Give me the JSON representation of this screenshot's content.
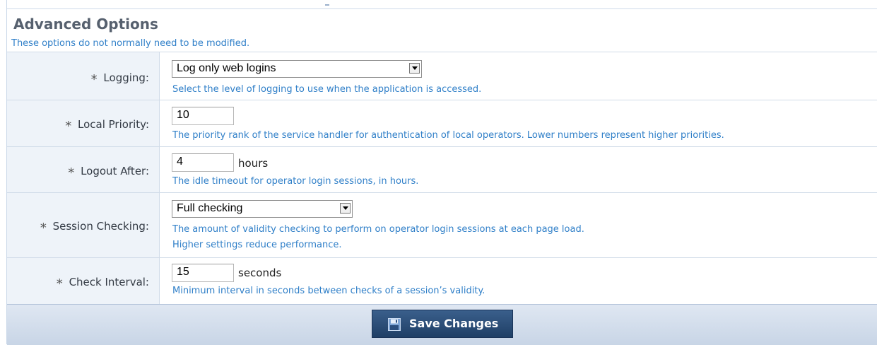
{
  "section": {
    "title": "Advanced Options",
    "subtitle": "These options do not normally need to be modified."
  },
  "rows": [
    {
      "label": "Logging:",
      "required": "*",
      "control": "select",
      "value": "Log only web logins",
      "help": "Select the level of logging to use when the application is accessed."
    },
    {
      "label": "Local Priority:",
      "required": "*",
      "control": "input",
      "value": "10",
      "help": "The priority rank of the service handler for authentication of local operators. Lower numbers represent higher priorities."
    },
    {
      "label": "Logout After:",
      "required": "*",
      "control": "input",
      "value": "4",
      "unit": "hours",
      "help": "The idle timeout for operator login sessions, in hours."
    },
    {
      "label": "Session Checking:",
      "required": "*",
      "control": "select",
      "value": "Full checking",
      "help": "The amount of validity checking to perform on operator login sessions at each page load.",
      "help2": "Higher settings reduce performance."
    },
    {
      "label": "Check Interval:",
      "required": "*",
      "control": "input",
      "value": "15",
      "unit": "seconds",
      "help": "Minimum interval in seconds between checks of a session’s validity."
    }
  ],
  "footer": {
    "save_label": "Save Changes",
    "save_icon": "floppy-disk-icon"
  }
}
